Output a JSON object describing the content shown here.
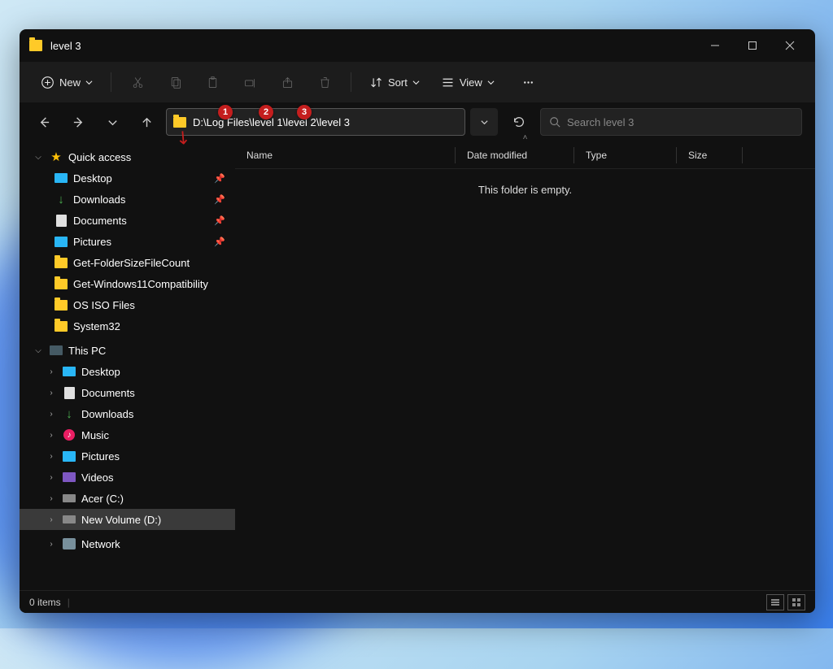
{
  "titlebar": {
    "title": "level 3"
  },
  "toolbar": {
    "new": "New",
    "sort": "Sort",
    "view": "View"
  },
  "address": {
    "path": "D:\\Log Files\\level 1\\level 2\\level 3"
  },
  "search": {
    "placeholder": "Search level 3"
  },
  "callouts": [
    "1",
    "2",
    "3"
  ],
  "columns": {
    "name": "Name",
    "date": "Date modified",
    "type": "Type",
    "size": "Size"
  },
  "empty_text": "This folder is empty.",
  "status": {
    "count": "0 items"
  },
  "sidebar": {
    "quick": "Quick access",
    "qitems": [
      {
        "label": "Desktop",
        "pin": true,
        "icon": "desktop"
      },
      {
        "label": "Downloads",
        "pin": true,
        "icon": "dl"
      },
      {
        "label": "Documents",
        "pin": true,
        "icon": "doc"
      },
      {
        "label": "Pictures",
        "pin": true,
        "icon": "pic"
      },
      {
        "label": "Get-FolderSizeFileCount",
        "pin": false,
        "icon": "folder"
      },
      {
        "label": "Get-Windows11Compatibility",
        "pin": false,
        "icon": "folder"
      },
      {
        "label": "OS ISO Files",
        "pin": false,
        "icon": "folder"
      },
      {
        "label": "System32",
        "pin": false,
        "icon": "folder"
      }
    ],
    "thispc": "This PC",
    "pcitems": [
      {
        "label": "Desktop",
        "icon": "desktop"
      },
      {
        "label": "Documents",
        "icon": "doc"
      },
      {
        "label": "Downloads",
        "icon": "dl"
      },
      {
        "label": "Music",
        "icon": "music"
      },
      {
        "label": "Pictures",
        "icon": "pic"
      },
      {
        "label": "Videos",
        "icon": "video"
      },
      {
        "label": "Acer (C:)",
        "icon": "drive"
      },
      {
        "label": "New Volume (D:)",
        "icon": "drive",
        "sel": true
      }
    ],
    "network": "Network"
  }
}
